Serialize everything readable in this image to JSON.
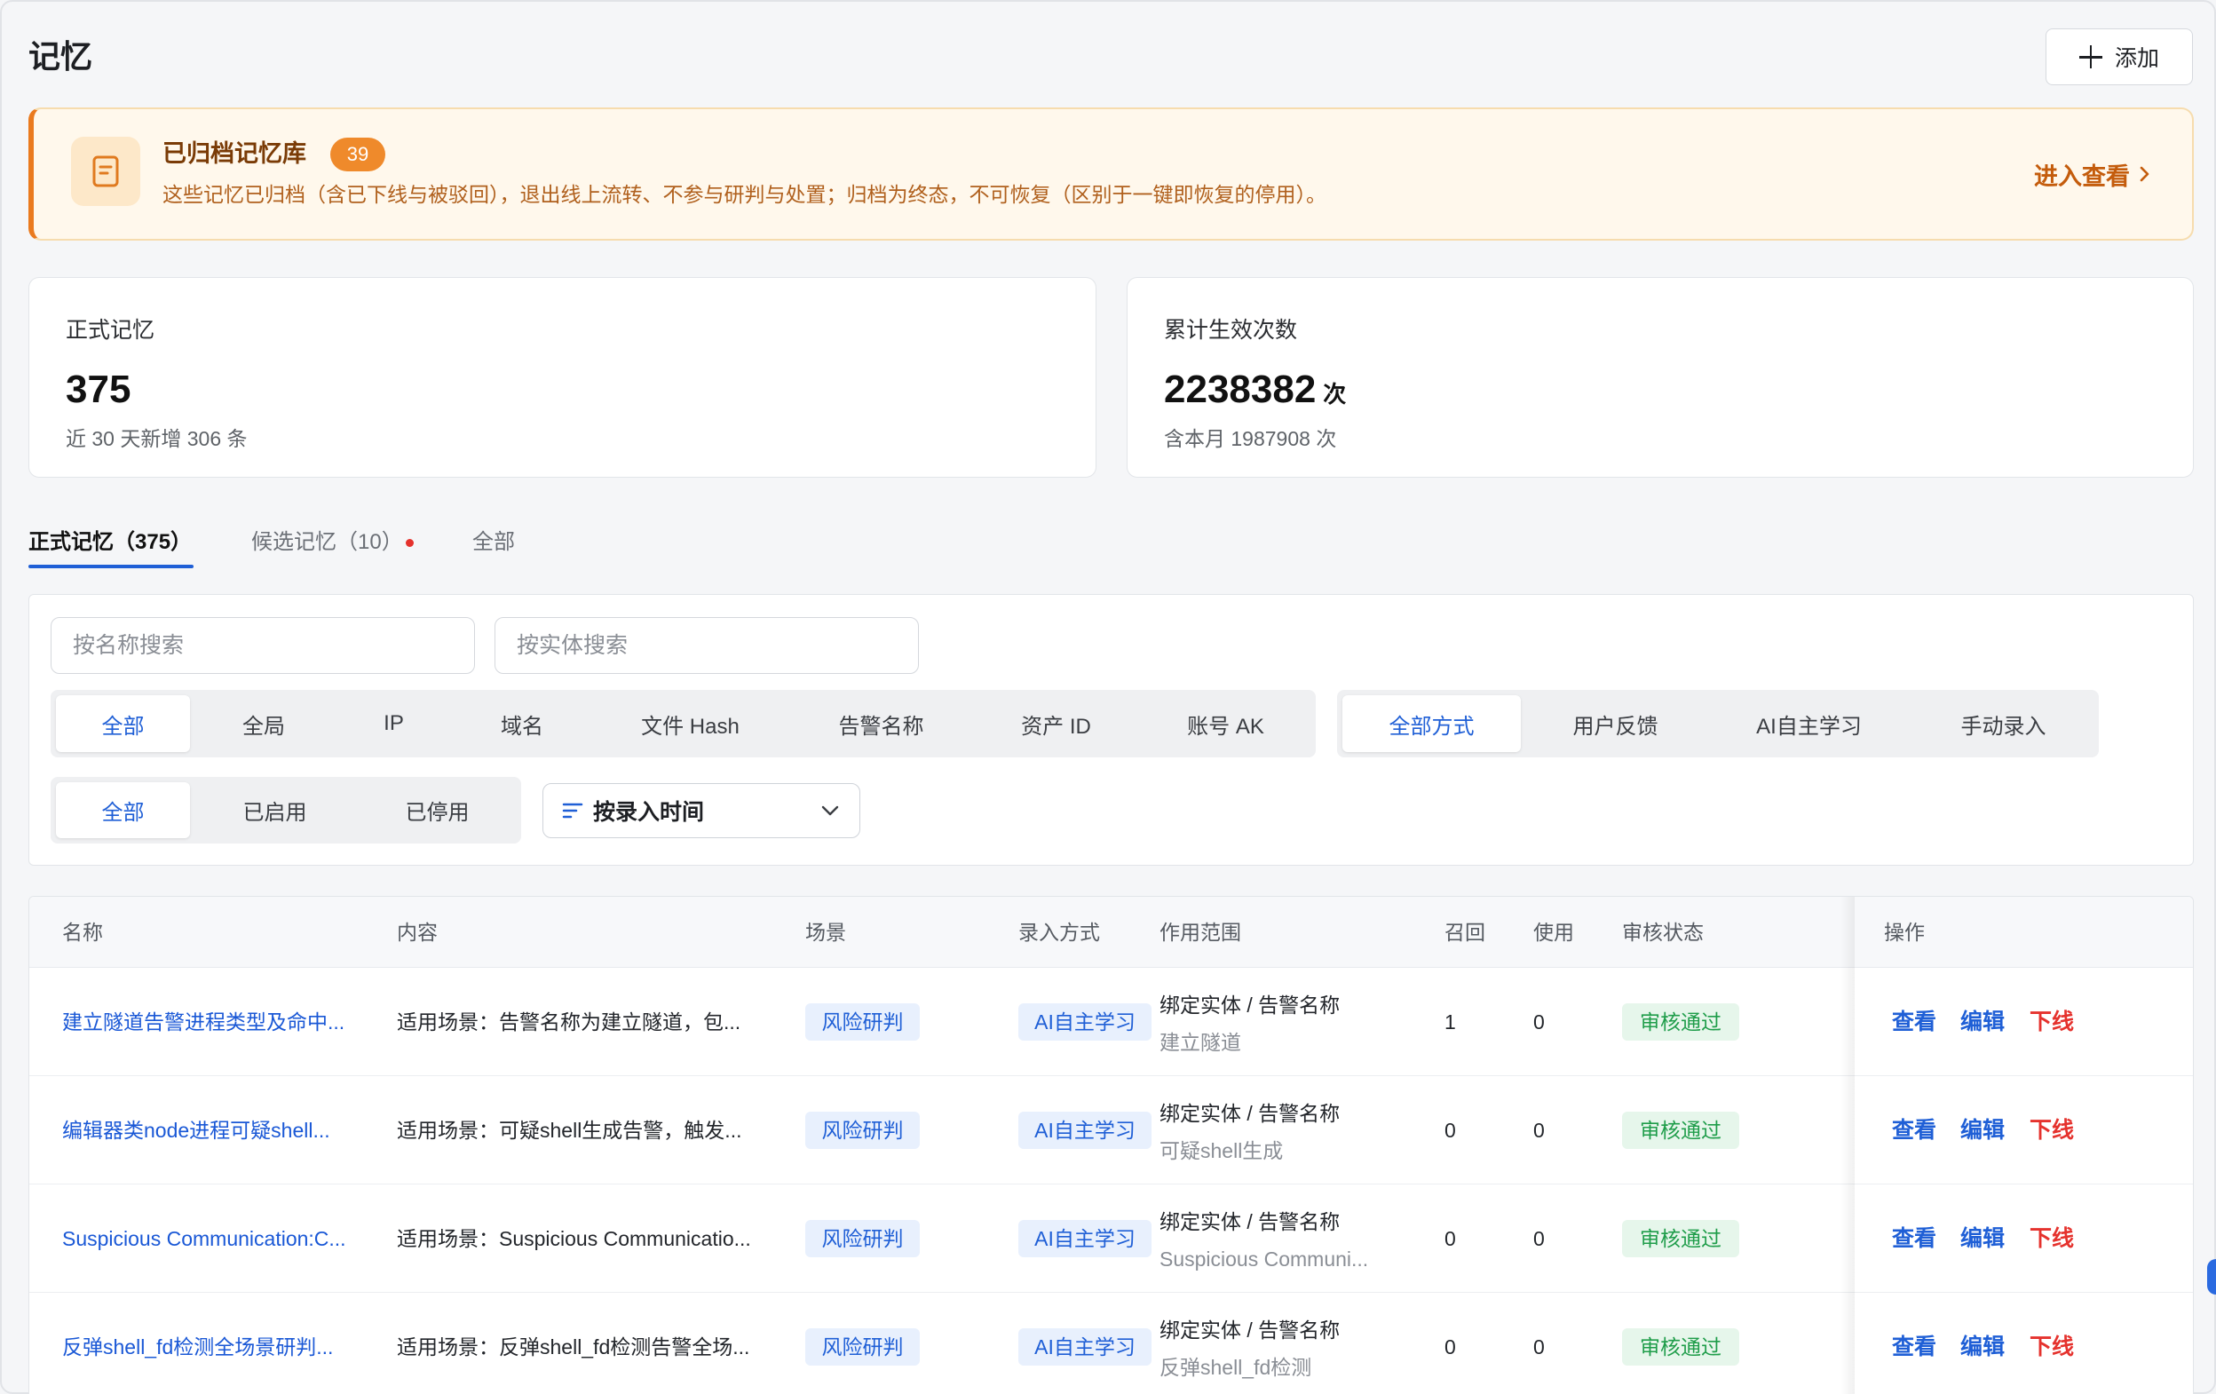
{
  "header": {
    "title": "记忆",
    "add_label": "添加"
  },
  "archive": {
    "title": "已归档记忆库",
    "count": "39",
    "description": "这些记忆已归档（含已下线与被驳回），退出线上流转、不参与研判与处置；归档为终态，不可恢复（区别于一键即恢复的停用）。",
    "link_label": "进入查看"
  },
  "stats": [
    {
      "label": "正式记忆",
      "value": "375",
      "sub": "近 30 天新增 306 条"
    },
    {
      "label": "累计生效次数",
      "value": "2238382",
      "unit": "次",
      "sub": "含本月 1987908 次"
    }
  ],
  "tabs": [
    {
      "label": "正式记忆（375）",
      "active": true
    },
    {
      "label": "候选记忆（10）",
      "has_dot": true
    },
    {
      "label": "全部"
    }
  ],
  "filters": {
    "name_search_placeholder": "按名称搜索",
    "entity_search_placeholder": "按实体搜索",
    "entity_types": [
      "全部",
      "全局",
      "IP",
      "域名",
      "文件 Hash",
      "告警名称",
      "资产 ID",
      "账号 AK"
    ],
    "methods": [
      "全部方式",
      "用户反馈",
      "AI自主学习",
      "手动录入"
    ],
    "statuses": [
      "全部",
      "已启用",
      "已停用"
    ],
    "sort_label": "按录入时间"
  },
  "table": {
    "columns": [
      "名称",
      "内容",
      "场景",
      "录入方式",
      "作用范围",
      "召回",
      "使用",
      "审核状态",
      "操作"
    ],
    "actions": [
      "查看",
      "编辑",
      "下线"
    ],
    "rows": [
      {
        "name": "建立隧道告警进程类型及命中...",
        "content": "适用场景：告警名称为建立隧道，包...",
        "scene": "风险研判",
        "method": "AI自主学习",
        "scope_type": "绑定实体 / 告警名称",
        "scope_value": "建立隧道",
        "recall": "1",
        "usage": "0",
        "review": "审核通过"
      },
      {
        "name": "编辑器类node进程可疑shell...",
        "content": "适用场景：可疑shell生成告警，触发...",
        "scene": "风险研判",
        "method": "AI自主学习",
        "scope_type": "绑定实体 / 告警名称",
        "scope_value": "可疑shell生成",
        "recall": "0",
        "usage": "0",
        "review": "审核通过"
      },
      {
        "name": "Suspicious Communication:C...",
        "content": "适用场景：Suspicious Communicatio...",
        "scene": "风险研判",
        "method": "AI自主学习",
        "scope_type": "绑定实体 / 告警名称",
        "scope_value": "Suspicious Communi...",
        "recall": "0",
        "usage": "0",
        "review": "审核通过"
      },
      {
        "name": "反弹shell_fd检测全场景研判...",
        "content": "适用场景：反弹shell_fd检测告警全场...",
        "scene": "风险研判",
        "method": "AI自主学习",
        "scope_type": "绑定实体 / 告警名称",
        "scope_value": "反弹shell_fd检测",
        "recall": "0",
        "usage": "0",
        "review": "审核通过"
      }
    ]
  },
  "icons": {
    "add": "plus-icon",
    "archive": "document-icon",
    "link": "chevron-right-icon",
    "sort": "sort-icon",
    "dropdown": "chevron-down-icon"
  },
  "colors": {
    "primary": "#1f5fd6",
    "danger": "#e5322d",
    "success": "#1f9d4a",
    "warning": "#ea7a1e",
    "banner_bg": "#fff8ec"
  }
}
